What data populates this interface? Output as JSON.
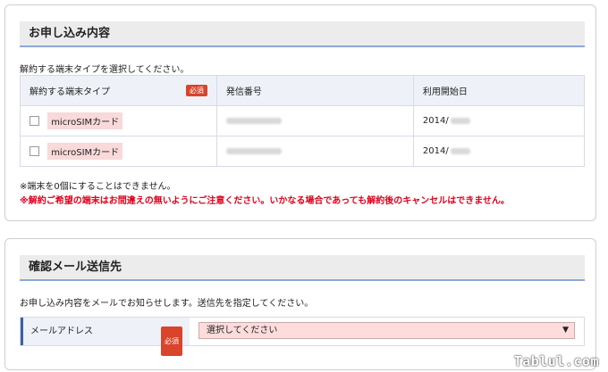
{
  "application": {
    "header": "お申し込み内容",
    "intro": "解約する端末タイプを選択してください。",
    "columns": [
      "解約する端末タイプ",
      "発信番号",
      "利用開始日"
    ],
    "required_label": "必須",
    "rows": [
      {
        "device": "microSIMカード",
        "start_prefix": "2014/"
      },
      {
        "device": "microSIMカード",
        "start_prefix": "2014/"
      }
    ],
    "note": "※端末を0個にすることはできません。",
    "warning": "※解約ご希望の端末はお間違えの無いようにご注意ください。いかなる場合であっても解約後のキャンセルはできません。"
  },
  "confirmation": {
    "header": "確認メール送信先",
    "intro": "お申し込み内容をメールでお知らせします。送信先を指定してください。",
    "email_label": "メールアドレス",
    "required_label": "必須",
    "select_value": "選択してください"
  },
  "watermark": "Tablul.com",
  "colors": {
    "required_badge": "#d9442b",
    "warning_text": "#e0001b",
    "header_underline": "#8fa8d6",
    "select_background": "#ffdcdc"
  }
}
